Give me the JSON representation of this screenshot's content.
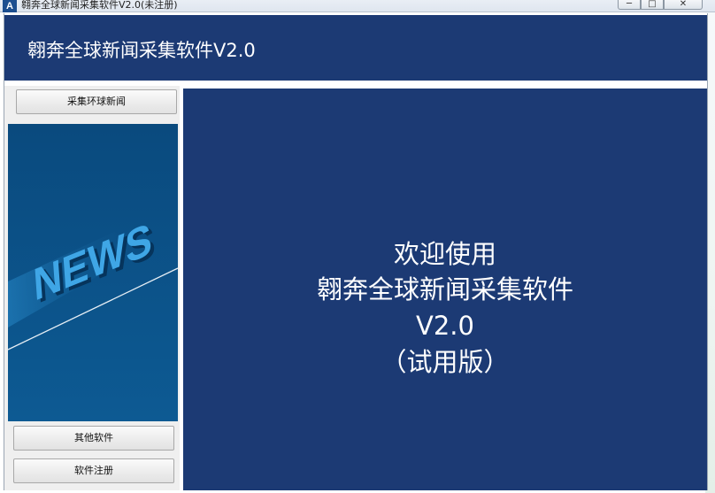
{
  "window": {
    "app_icon_text": "A",
    "title": "翱奔全球新闻采集软件V2.0(未注册)",
    "min_glyph": "─",
    "max_glyph": "□",
    "close_glyph": "✕"
  },
  "header": {
    "title": "翱奔全球新闻采集软件V2.0"
  },
  "sidebar": {
    "collect_button": "采集环球新闻",
    "other_button": "其他软件",
    "register_button": "软件注册",
    "news_graphic_text": "NEWS"
  },
  "main": {
    "line1": "欢迎使用",
    "line2": "翱奔全球新闻采集软件",
    "line3": "V2.0",
    "line4": "（试用版）"
  },
  "colors": {
    "header_bg": "#1c3a74",
    "main_bg": "#1c3a74",
    "news_bg": "#0b4d82"
  }
}
